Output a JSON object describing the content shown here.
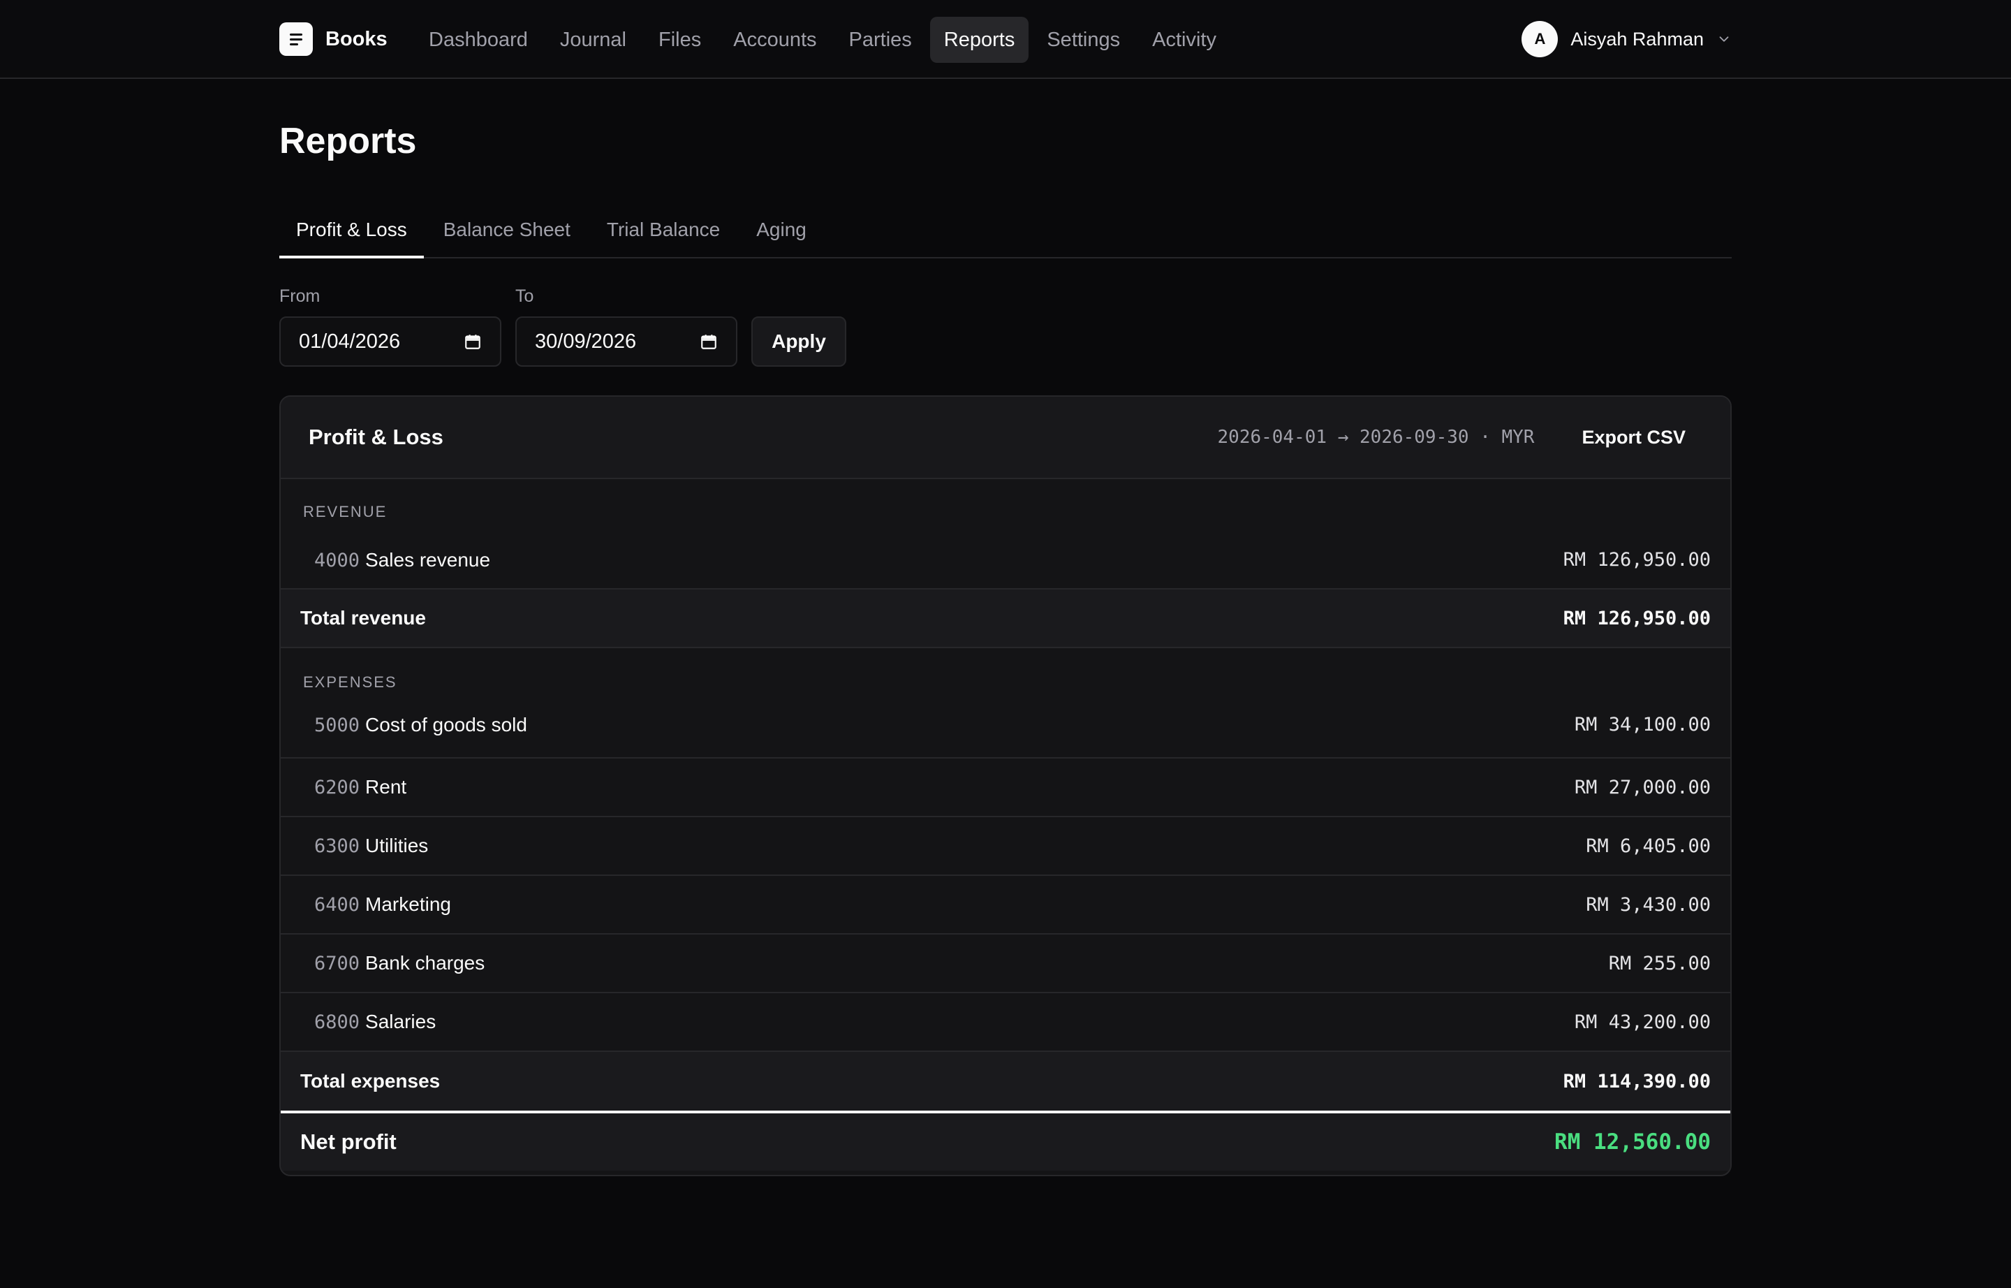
{
  "app": {
    "name": "Books"
  },
  "nav": {
    "items": [
      {
        "label": "Dashboard",
        "active": false
      },
      {
        "label": "Journal",
        "active": false
      },
      {
        "label": "Files",
        "active": false
      },
      {
        "label": "Accounts",
        "active": false
      },
      {
        "label": "Parties",
        "active": false
      },
      {
        "label": "Reports",
        "active": true
      },
      {
        "label": "Settings",
        "active": false
      },
      {
        "label": "Activity",
        "active": false
      }
    ]
  },
  "user": {
    "initial": "A",
    "name": "Aisyah Rahman"
  },
  "page": {
    "title": "Reports"
  },
  "tabs": [
    {
      "label": "Profit & Loss",
      "active": true
    },
    {
      "label": "Balance Sheet",
      "active": false
    },
    {
      "label": "Trial Balance",
      "active": false
    },
    {
      "label": "Aging",
      "active": false
    }
  ],
  "filters": {
    "from_label": "From",
    "from_value": "01/04/2026",
    "to_label": "To",
    "to_value": "30/09/2026",
    "apply_label": "Apply"
  },
  "report": {
    "title": "Profit & Loss",
    "range": "2026-04-01 → 2026-09-30 · MYR",
    "export_label": "Export CSV",
    "revenue": {
      "label": "REVENUE",
      "rows": [
        {
          "code": "4000",
          "name": "Sales revenue",
          "amount": "RM 126,950.00"
        }
      ],
      "total_label": "Total revenue",
      "total_amount": "RM 126,950.00"
    },
    "expenses": {
      "label": "EXPENSES",
      "rows": [
        {
          "code": "5000",
          "name": "Cost of goods sold",
          "amount": "RM 34,100.00"
        },
        {
          "code": "6200",
          "name": "Rent",
          "amount": "RM 27,000.00"
        },
        {
          "code": "6300",
          "name": "Utilities",
          "amount": "RM 6,405.00"
        },
        {
          "code": "6400",
          "name": "Marketing",
          "amount": "RM 3,430.00"
        },
        {
          "code": "6700",
          "name": "Bank charges",
          "amount": "RM 255.00"
        },
        {
          "code": "6800",
          "name": "Salaries",
          "amount": "RM 43,200.00"
        }
      ],
      "total_label": "Total expenses",
      "total_amount": "RM 114,390.00"
    },
    "net_label": "Net profit",
    "net_amount": "RM 12,560.00"
  },
  "colors": {
    "accent_positive": "#4ade80",
    "background": "#09090b"
  }
}
